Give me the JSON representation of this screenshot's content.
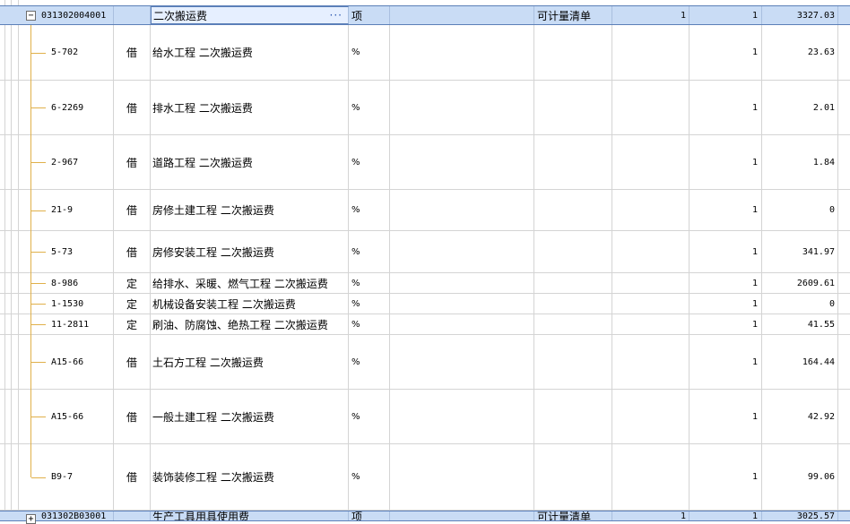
{
  "rows": [
    {
      "code": "031302004001",
      "type": "",
      "name": "二次搬运费",
      "unit": "项",
      "category": "可计量清单",
      "qty1": "1",
      "qty2": "1",
      "amount": "3327.03"
    },
    {
      "code": "5-702",
      "type": "借",
      "name": "给水工程 二次搬运费",
      "unit": "%",
      "qty2": "1",
      "amount": "23.63"
    },
    {
      "code": "6-2269",
      "type": "借",
      "name": "排水工程 二次搬运费",
      "unit": "%",
      "qty2": "1",
      "amount": "2.01"
    },
    {
      "code": "2-967",
      "type": "借",
      "name": "道路工程 二次搬运费",
      "unit": "%",
      "qty2": "1",
      "amount": "1.84"
    },
    {
      "code": "21-9",
      "type": "借",
      "name": "房修土建工程 二次搬运费",
      "unit": "%",
      "qty2": "1",
      "amount": "0"
    },
    {
      "code": "5-73",
      "type": "借",
      "name": "房修安装工程 二次搬运费",
      "unit": "%",
      "qty2": "1",
      "amount": "341.97"
    },
    {
      "code": "8-986",
      "type": "定",
      "name": "给排水、采暖、燃气工程 二次搬运费",
      "unit": "%",
      "qty2": "1",
      "amount": "2609.61"
    },
    {
      "code": "1-1530",
      "type": "定",
      "name": "机械设备安装工程 二次搬运费",
      "unit": "%",
      "qty2": "1",
      "amount": "0"
    },
    {
      "code": "11-2811",
      "type": "定",
      "name": "刷油、防腐蚀、绝热工程 二次搬运费",
      "unit": "%",
      "qty2": "1",
      "amount": "41.55"
    },
    {
      "code": "A15-66",
      "type": "借",
      "name": "土石方工程 二次搬运费",
      "unit": "%",
      "qty2": "1",
      "amount": "164.44"
    },
    {
      "code": "A15-66",
      "type": "借",
      "name": "一般土建工程 二次搬运费",
      "unit": "%",
      "qty2": "1",
      "amount": "42.92"
    },
    {
      "code": "B9-7",
      "type": "借",
      "name": "装饰装修工程 二次搬运费",
      "unit": "%",
      "qty2": "1",
      "amount": "99.06"
    },
    {
      "code": "031302B03001",
      "type": "",
      "name": "生产工具用具使用费",
      "unit": "项",
      "category": "可计量清单",
      "qty1": "1",
      "qty2": "1",
      "amount": "3025.57"
    }
  ],
  "icons": {
    "expand_collapse": "minus-box-icon",
    "expand_more": "plus-box-icon",
    "edit_more": "ellipsis-icon"
  }
}
